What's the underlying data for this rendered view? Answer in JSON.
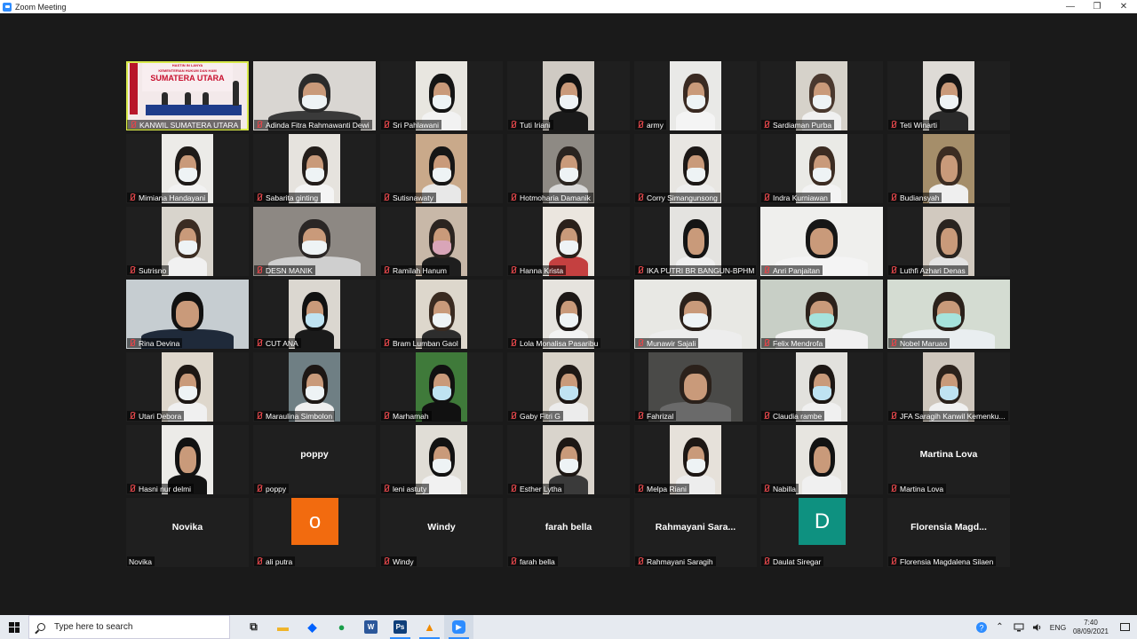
{
  "window": {
    "title": "Zoom Meeting",
    "minimize": "—",
    "maximize": "❐",
    "close": "✕"
  },
  "tiles": [
    {
      "name": "KANWIL SUMATERA UTARA",
      "active": true,
      "kind": "banner",
      "banner_lines": [
        "HASTIN IN LANYA",
        "KEMENTERIAN HUKUM DAN HAM",
        "SUMATERA UTARA"
      ]
    },
    {
      "name": "Adinda Fitra Rahmawanti Dewi",
      "kind": "wide",
      "bg": "#d9d6d2",
      "head": "#2b2b2b",
      "mask": true,
      "torso": "#3a3a3a"
    },
    {
      "name": "Sri Pahlawani",
      "kind": "narrow",
      "bg": "#e8e6e0",
      "head": "#151515",
      "mask": true,
      "torso": "#f2f2f2"
    },
    {
      "name": "Tuti Iriani",
      "kind": "narrow",
      "bg": "#cfcac3",
      "head": "#111111",
      "mask": true,
      "torso": "#1a1a1a"
    },
    {
      "name": "army",
      "kind": "narrow",
      "bg": "#e9e9e7",
      "head": "#3a2a22",
      "mask": true,
      "torso": "#f4f4f4"
    },
    {
      "name": "Sardiaman Purba",
      "kind": "narrow",
      "bg": "#d6d2ca",
      "head": "#4a382e",
      "mask": true,
      "torso": "#f0f0f0"
    },
    {
      "name": "Teti Winarti",
      "kind": "narrow",
      "bg": "#dedbd6",
      "head": "#151515",
      "mask": true,
      "torso": "#2a2a2a"
    },
    {
      "name": "Mimiana Handayani",
      "kind": "narrow",
      "bg": "#ecebe8",
      "head": "#1e1a18",
      "mask": true,
      "torso": "#f2f2f2"
    },
    {
      "name": "Sabarita ginting",
      "kind": "narrow",
      "bg": "#e6e3de",
      "head": "#231d1a",
      "mask": true,
      "torso": "#f4f4f4"
    },
    {
      "name": "Sutisnawaty",
      "kind": "narrow",
      "bg": "#c9a98a",
      "head": "#161616",
      "mask": true,
      "torso": "#e8e8e8"
    },
    {
      "name": "Hotmoharia Damanik",
      "kind": "narrow",
      "bg": "#8e8a84",
      "head": "#2a2420",
      "mask": true,
      "torso": "#d8d8d8"
    },
    {
      "name": "Corry Simangunsong",
      "kind": "narrow",
      "bg": "#e8e6e2",
      "head": "#1c1816",
      "mask": true,
      "torso": "#eeeeee"
    },
    {
      "name": "Indra Kurniawan",
      "kind": "narrow",
      "bg": "#eaeae6",
      "head": "#3c2c22",
      "mask": true,
      "torso": "#f3f3f3"
    },
    {
      "name": "Budiansyah",
      "kind": "narrow",
      "bg": "#a58e6a",
      "head": "#3c2c22",
      "mask": false,
      "torso": "#efefef"
    },
    {
      "name": "Sutrisno",
      "kind": "narrow",
      "bg": "#d8d4cc",
      "head": "#3b2c22",
      "mask": true,
      "torso": "#f1f1f1"
    },
    {
      "name": "DESN  MANIK",
      "kind": "wide",
      "bg": "#8d8883",
      "head": "#2a2625",
      "mask": true,
      "torso": "#cfcfcf"
    },
    {
      "name": "Ramilah Hanum",
      "kind": "narrow",
      "bg": "#c8b8a8",
      "head": "#2b2420",
      "mask": true,
      "torso": "#1e1e1e",
      "maskColor": "#d9a5b8"
    },
    {
      "name": "Hanna Krista",
      "kind": "narrow",
      "bg": "#ebe6df",
      "head": "#2a201a",
      "mask": true,
      "torso": "#c44040"
    },
    {
      "name": "IKA PUTRI BR BANGUN-BPHM",
      "kind": "narrow",
      "bg": "#e4e3e0",
      "head": "#141414",
      "mask": false,
      "torso": "#efefef"
    },
    {
      "name": "Anri Panjaitan",
      "kind": "wide",
      "bg": "#efefed",
      "head": "#161616",
      "mask": false,
      "torso": "#f4f4f4"
    },
    {
      "name": "Luthfi Azhari Denas",
      "kind": "narrow",
      "bg": "#d1c9bf",
      "head": "#2a2420",
      "mask": false,
      "torso": "#e3e3e3"
    },
    {
      "name": "Rina Devina",
      "kind": "wide",
      "bg": "#c6cdd1",
      "head": "#111111",
      "mask": false,
      "torso": "#1f2a3a"
    },
    {
      "name": "CUT ANA",
      "kind": "narrow",
      "bg": "#dbd7d0",
      "head": "#111111",
      "mask": true,
      "torso": "#1a1a1a",
      "maskColor": "#bfe3f2"
    },
    {
      "name": "Bram Lumban Gaol",
      "kind": "narrow",
      "bg": "#ddd7cc",
      "head": "#3a2b21",
      "mask": true,
      "torso": "#2d2d2d"
    },
    {
      "name": "Lola Monalisa Pasaribu",
      "kind": "narrow",
      "bg": "#e6e3de",
      "head": "#1d1816",
      "mask": true,
      "torso": "#f3f3f3"
    },
    {
      "name": "Munawir Sajali",
      "kind": "wide",
      "bg": "#e8e8e4",
      "head": "#2b211b",
      "mask": true,
      "torso": "#ededed"
    },
    {
      "name": "Felix Mendrofa",
      "kind": "wide",
      "bg": "#c8cfc6",
      "head": "#2b211b",
      "mask": true,
      "torso": "#f0f0f0",
      "maskColor": "#a6e3dc"
    },
    {
      "name": "Nobel Maruao",
      "kind": "wide",
      "bg": "#d4dcd2",
      "head": "#2b211b",
      "mask": true,
      "torso": "#e9eef0",
      "maskColor": "#a6e3dc"
    },
    {
      "name": "Utari Debora",
      "kind": "narrow",
      "bg": "#ded7cc",
      "head": "#1d1714",
      "mask": true,
      "torso": "#f0f0f0"
    },
    {
      "name": "Maraulina Simbolon",
      "kind": "narrow",
      "bg": "#6f7f84",
      "head": "#1d1714",
      "mask": true,
      "torso": "#efefef"
    },
    {
      "name": "Marhamah",
      "kind": "narrow",
      "bg": "#3f7a3a",
      "head": "#111111",
      "mask": true,
      "torso": "#111111",
      "maskColor": "#bfe3f2"
    },
    {
      "name": "Gaby Fitri G",
      "kind": "narrow",
      "bg": "#d8d2c8",
      "head": "#1d1714",
      "mask": true,
      "torso": "#ececec",
      "maskColor": "#bfe3f2"
    },
    {
      "name": "Fahrizal",
      "kind": "mid",
      "bg": "#4a4a48",
      "head": "#2b211b",
      "mask": false,
      "torso": "#6a6a6a"
    },
    {
      "name": "Claudia rambe",
      "kind": "narrow",
      "bg": "#e2e1dd",
      "head": "#1d1714",
      "mask": true,
      "torso": "#f0f0f0",
      "maskColor": "#bfe3f2"
    },
    {
      "name": "JFA Saragih Kanwil Kemenku...",
      "kind": "narrow",
      "bg": "#cfc7bd",
      "head": "#2b211b",
      "mask": true,
      "torso": "#f0f0f0",
      "maskColor": "#bfe3f2"
    },
    {
      "name": "Hasni nur delmi",
      "kind": "narrow",
      "bg": "#ecebe8",
      "head": "#121212",
      "mask": false,
      "torso": "#121212"
    },
    {
      "name": "poppy",
      "kind": "text",
      "center": "poppy"
    },
    {
      "name": "leni astuty",
      "kind": "narrow",
      "bg": "#e0ddd6",
      "head": "#121212",
      "mask": true,
      "torso": "#f1f1f1"
    },
    {
      "name": "Esther Lytha",
      "kind": "narrow",
      "bg": "#d9d4cc",
      "head": "#1d1714",
      "mask": true,
      "torso": "#3a3a3a"
    },
    {
      "name": "Melpa Riani",
      "kind": "narrow",
      "bg": "#e6e1da",
      "head": "#1d1714",
      "mask": true,
      "torso": "#ededed"
    },
    {
      "name": "Nabilla",
      "kind": "narrow",
      "bg": "#e7e5e0",
      "head": "#121212",
      "mask": false,
      "torso": "#f0f0f0"
    },
    {
      "name": "Martina Lova",
      "kind": "text",
      "center": "Martina Lova"
    },
    {
      "name": "Novika",
      "kind": "text",
      "center": "Novika",
      "muted": false
    },
    {
      "name": "ali putra",
      "kind": "avatar",
      "letter": "o",
      "color": "#f26b0f"
    },
    {
      "name": "Windy",
      "kind": "text",
      "center": "Windy"
    },
    {
      "name": "farah bella",
      "kind": "text",
      "center": "farah bella"
    },
    {
      "name": "Rahmayani Saragih",
      "kind": "text",
      "center": "Rahmayani  Sara..."
    },
    {
      "name": "Daulat Siregar",
      "kind": "avatar",
      "letter": "D",
      "color": "#0e9180"
    },
    {
      "name": "Florensia Magdalena Silaen",
      "kind": "text",
      "center": "Florensia  Magd..."
    }
  ],
  "taskbar": {
    "search_placeholder": "Type here to search",
    "apps": [
      {
        "icon": "task-view-icon",
        "label": "⧉",
        "color": "#222222"
      },
      {
        "icon": "file-explorer-icon",
        "label": "▬",
        "color": "#f0b429"
      },
      {
        "icon": "dropbox-icon",
        "label": "◆",
        "color": "#0061fe"
      },
      {
        "icon": "chrome-icon",
        "label": "●",
        "color": "#1a9e4a"
      },
      {
        "icon": "word-icon",
        "label": "W",
        "color": "#2b579a"
      },
      {
        "icon": "photoshop-icon",
        "label": "Ps",
        "color": "#0f3f7a"
      },
      {
        "icon": "vlc-icon",
        "label": "▲",
        "color": "#f08a00"
      },
      {
        "icon": "zoom-icon",
        "label": "▶",
        "color": "#2d8cff"
      }
    ],
    "tray": {
      "lang": "ENG",
      "time": "7:40",
      "date": "08/09/2021"
    }
  }
}
